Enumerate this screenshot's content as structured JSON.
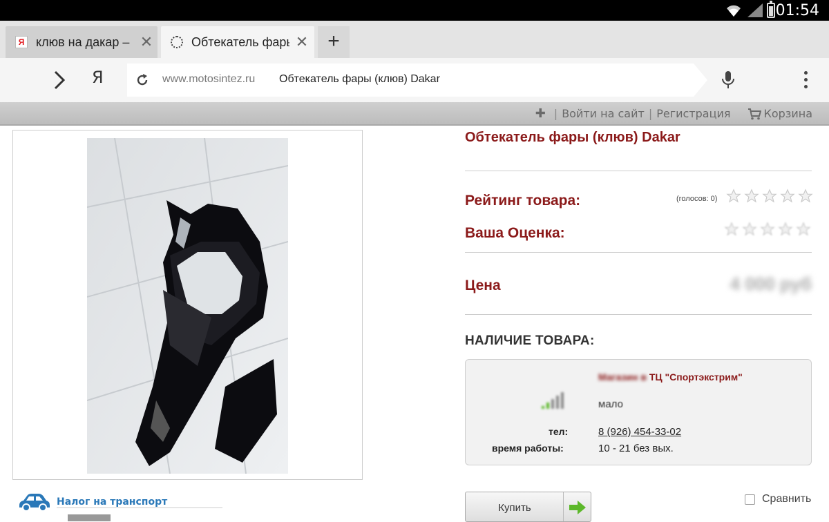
{
  "status_bar": {
    "time": "01:54",
    "wifi_icon": "wifi-icon",
    "signal_icon": "signal-icon",
    "battery_icon": "battery-icon"
  },
  "tabs": [
    {
      "title": "клюв на дакар –",
      "favicon": "yandex-favicon",
      "active": false
    },
    {
      "title": "Обтекатель фары (клюв) Dakar",
      "favicon": "loading-favicon",
      "active": true
    }
  ],
  "toolbar": {
    "yandex_button": "Я",
    "url_host": "www.motosintez.ru",
    "url_title": "Обтекатель фары (клюв) Dakar"
  },
  "site_header": {
    "login": "Войти на сайт",
    "register": "Регистрация",
    "cart": "Корзина"
  },
  "product": {
    "title": "Обтекатель фары (клюв) Dakar",
    "rating_label": "Рейтинг товара:",
    "votes": "(голосов: 0)",
    "rating_value": 0,
    "your_rating_label": "Ваша Оценка:",
    "price_label": "Цена",
    "price_value": "4 000 руб",
    "availability_heading": "НАЛИЧИЕ ТОВАРА:"
  },
  "store": {
    "name_prefix": "Магазин в",
    "name_rest": " ТЦ \"Спортэкстрим\"",
    "stock": "мало",
    "tel_label": "тел:",
    "tel": "8 (926) 454-33-02",
    "hours_label": "время работы:",
    "hours": "10 - 21 без вых."
  },
  "actions": {
    "buy": "Купить",
    "compare": "Сравнить"
  },
  "footer": {
    "tax_link": "Налог на транспорт"
  },
  "colors": {
    "accent_red": "#8b1a1a",
    "link_blue": "#2a78b8",
    "buy_arrow_green": "#5cb82a"
  }
}
